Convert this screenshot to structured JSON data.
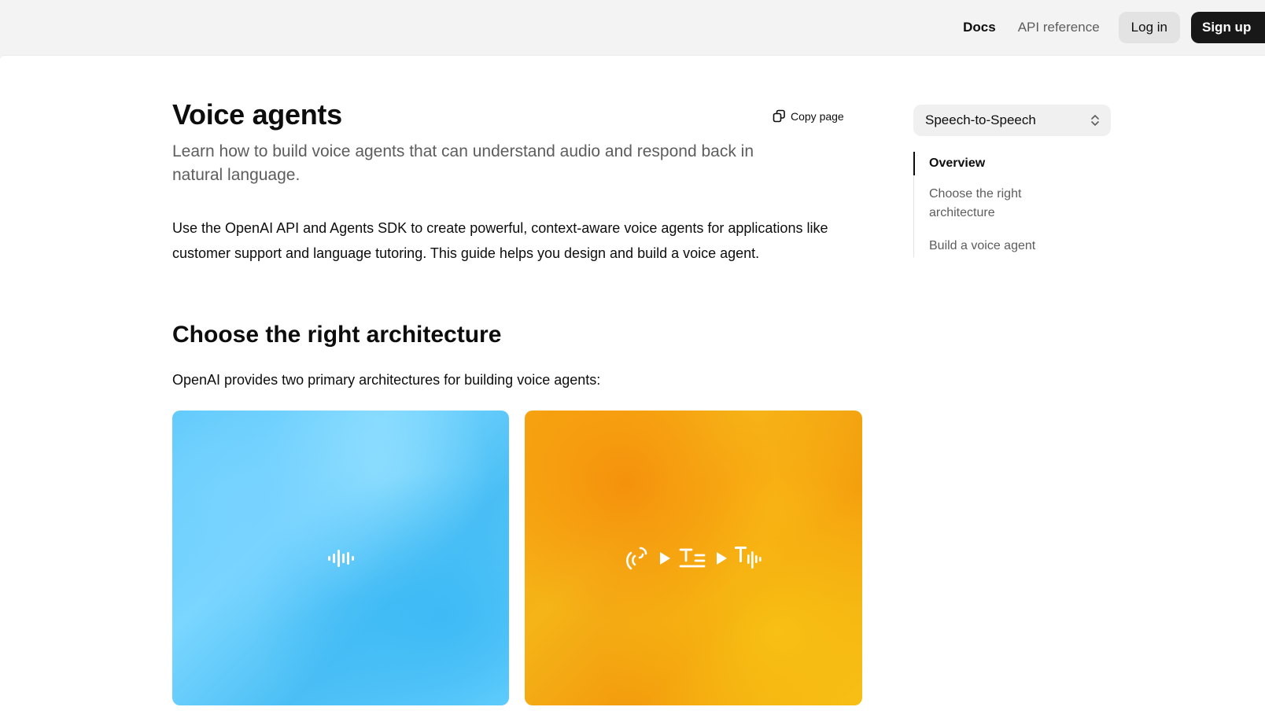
{
  "nav": {
    "docs": "Docs",
    "api_reference": "API reference",
    "login": "Log in",
    "signup": "Sign up"
  },
  "page": {
    "title": "Voice agents",
    "copy_page": "Copy page",
    "subtitle": "Learn how to build voice agents that can understand audio and respond back in natural language.",
    "intro": "Use the OpenAI API and Agents SDK to create powerful, context-aware voice agents for applications like customer support and language tutoring. This guide helps you design and build a voice agent.",
    "section_heading": "Choose the right architecture",
    "section_paragraph": "OpenAI provides two primary architectures for building voice agents:"
  },
  "cards": [
    {
      "theme": "blue",
      "color": "#5cc9fa",
      "icon": "audio-waveform-icon"
    },
    {
      "theme": "orange",
      "color": "#f7a510",
      "icons": [
        "speech-recognition-icon",
        "play-arrow-icon",
        "text-lines-icon",
        "play-arrow-icon",
        "text-to-speech-icon"
      ]
    }
  ],
  "sidebar": {
    "select_value": "Speech-to-Speech",
    "toc": [
      {
        "label": "Overview",
        "active": true
      },
      {
        "label": "Choose the right architecture",
        "active": false
      },
      {
        "label": "Build a voice agent",
        "active": false
      }
    ]
  },
  "colors": {
    "accent_dark": "#181818",
    "muted_text": "#5d5d5d",
    "topbar_bg": "#f3f3f3"
  }
}
